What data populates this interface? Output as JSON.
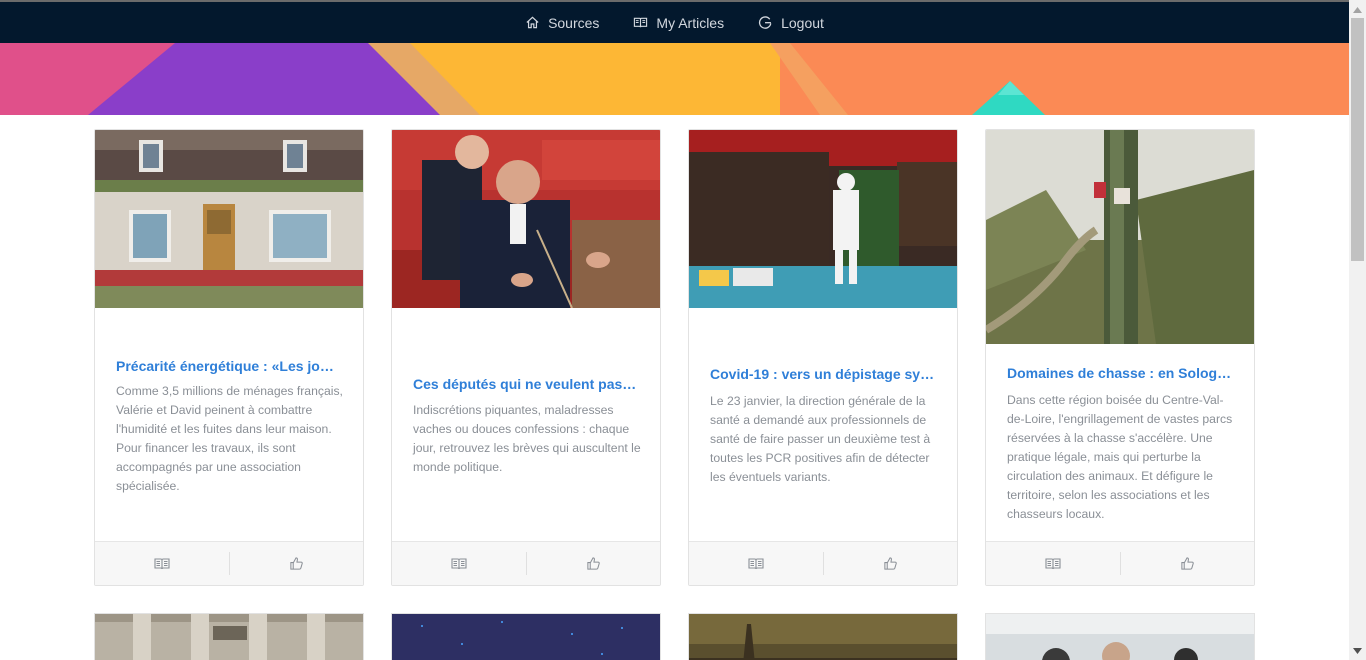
{
  "nav": {
    "sources": "Sources",
    "my_articles": "My Articles",
    "logout": "Logout"
  },
  "colors": {
    "navbar": "#03182d",
    "title": "#2f7fd8",
    "banner": [
      "#e0508a",
      "#8a3ec9",
      "#fdb735",
      "#fb8a55",
      "#2fd9c2"
    ]
  },
  "articles": [
    {
      "title": "Précarité énergétique : «Les jour…",
      "text": "Comme 3,5 millions de ménages français, Valérie et David peinent à combattre l'humidité et les fuites dans leur maison. Pour financer les travaux, ils sont accompagnés par une association spécialisée."
    },
    {
      "title": "Ces députés qui ne veulent pas …",
      "text": "Indiscrétions piquantes, maladresses vaches ou douces confessions : chaque jour, retrouvez les brèves qui auscultent le monde politique."
    },
    {
      "title": "Covid-19 : vers un dépistage sys…",
      "text": "Le 23 janvier, la direction générale de la santé a demandé aux professionnels de santé de faire passer un deuxième test à toutes les PCR positives afin de détecter les éventuels variants."
    },
    {
      "title": "Domaines de chasse : en Sologn…",
      "text": "Dans cette région boisée du Centre-Val-de-Loire, l'engrillagement de vastes parcs réservées à la chasse s'accélère. Une pratique légale, mais qui perturbe la circulation des animaux. Et défigure le territoire, selon les associations et les chasseurs locaux."
    }
  ]
}
